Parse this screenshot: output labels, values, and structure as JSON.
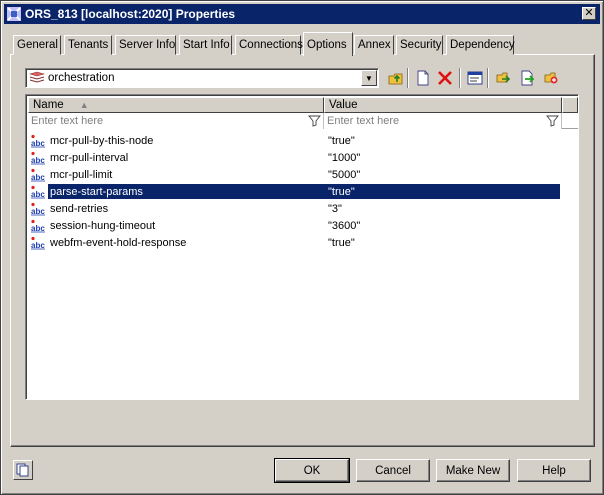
{
  "window": {
    "title": "ORS_813 [localhost:2020] Properties",
    "close_label": "✕"
  },
  "tabs": [
    {
      "label": "General"
    },
    {
      "label": "Tenants"
    },
    {
      "label": "Server Info"
    },
    {
      "label": "Start Info"
    },
    {
      "label": "Connections"
    },
    {
      "label": "Options",
      "active": true
    },
    {
      "label": "Annex"
    },
    {
      "label": "Security"
    },
    {
      "label": "Dependency"
    }
  ],
  "section_combo": {
    "value": "orchestration",
    "icon": "section-stack-icon"
  },
  "toolbar": {
    "icons": [
      "up-folder-icon",
      "new-item-icon",
      "delete-icon",
      "properties-icon",
      "copy-icon",
      "paste-icon",
      "export-icon"
    ]
  },
  "grid": {
    "columns": [
      "Name",
      "Value"
    ],
    "filter_placeholder": "Enter text here",
    "rows": [
      {
        "name": "mcr-pull-by-this-node",
        "value": "\"true\""
      },
      {
        "name": "mcr-pull-interval",
        "value": "\"1000\""
      },
      {
        "name": "mcr-pull-limit",
        "value": "\"5000\""
      },
      {
        "name": "parse-start-params",
        "value": "\"true\"",
        "selected": true
      },
      {
        "name": "send-retries",
        "value": "\"3\""
      },
      {
        "name": "session-hung-timeout",
        "value": "\"3600\""
      },
      {
        "name": "webfm-event-hold-response",
        "value": "\"true\""
      }
    ]
  },
  "buttons": {
    "ok": "OK",
    "cancel": "Cancel",
    "make_new": "Make New",
    "help": "Help"
  },
  "colors": {
    "title_bar": "#0a246a",
    "selection": "#0a246a",
    "face": "#d4d0c8"
  }
}
